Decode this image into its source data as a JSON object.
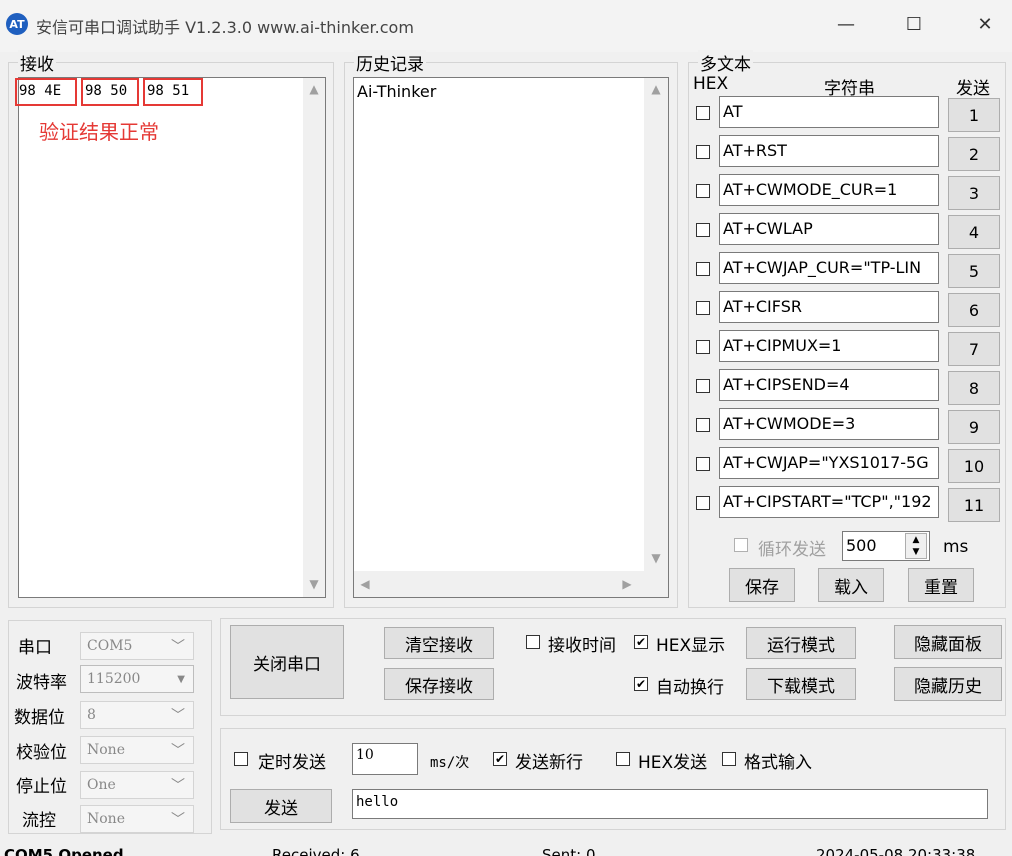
{
  "window": {
    "title": "安信可串口调试助手 V1.2.3.0    www.ai-thinker.com",
    "icon_text": "AT"
  },
  "receive": {
    "label": "接收",
    "bytes": [
      "98 4E",
      "98 50",
      "98 51"
    ],
    "note": "验证结果正常"
  },
  "history": {
    "label": "历史记录",
    "items": [
      "Ai-Thinker"
    ]
  },
  "multitext": {
    "label": "多文本",
    "col_hex": "HEX",
    "col_string": "字符串",
    "col_send": "发送",
    "rows": [
      {
        "text": "AT",
        "num": "1"
      },
      {
        "text": "AT+RST",
        "num": "2"
      },
      {
        "text": "AT+CWMODE_CUR=1",
        "num": "3"
      },
      {
        "text": "AT+CWLAP",
        "num": "4"
      },
      {
        "text": "AT+CWJAP_CUR=\"TP-LIN",
        "num": "5"
      },
      {
        "text": "AT+CIFSR",
        "num": "6"
      },
      {
        "text": "AT+CIPMUX=1",
        "num": "7"
      },
      {
        "text": "AT+CIPSEND=4",
        "num": "8"
      },
      {
        "text": "AT+CWMODE=3",
        "num": "9"
      },
      {
        "text": "AT+CWJAP=\"YXS1017-5G",
        "num": "10"
      },
      {
        "text": "AT+CIPSTART=\"TCP\",\"192",
        "num": "11"
      }
    ],
    "loop_label": "循环发送",
    "loop_value": "500",
    "loop_unit": "ms",
    "save": "保存",
    "load": "载入",
    "reset": "重置"
  },
  "serial": {
    "port_label": "串口",
    "port_value": "COM5",
    "baud_label": "波特率",
    "baud_value": "115200",
    "data_label": "数据位",
    "data_value": "8",
    "parity_label": "校验位",
    "parity_value": "None",
    "stop_label": "停止位",
    "stop_value": "One",
    "flow_label": "流控",
    "flow_value": "None"
  },
  "controls": {
    "close_port": "关闭串口",
    "clear_recv": "清空接收",
    "save_recv": "保存接收",
    "recv_time": "接收时间",
    "hex_display": "HEX显示",
    "auto_wrap": "自动换行",
    "run_mode": "运行模式",
    "download_mode": "下载模式",
    "hide_panel": "隐藏面板",
    "hide_history": "隐藏历史"
  },
  "send": {
    "timed_send": "定时发送",
    "interval": "10",
    "interval_unit": "ms/次",
    "send_newline": "发送新行",
    "hex_send": "HEX发送",
    "format_input": "格式输入",
    "send_button": "发送",
    "send_text": "hello"
  },
  "statusbar": {
    "port": "COM5 Opened",
    "received": "Received: 6",
    "sent": "Sent: 0",
    "time": "2024-05-08 20:33:38"
  }
}
